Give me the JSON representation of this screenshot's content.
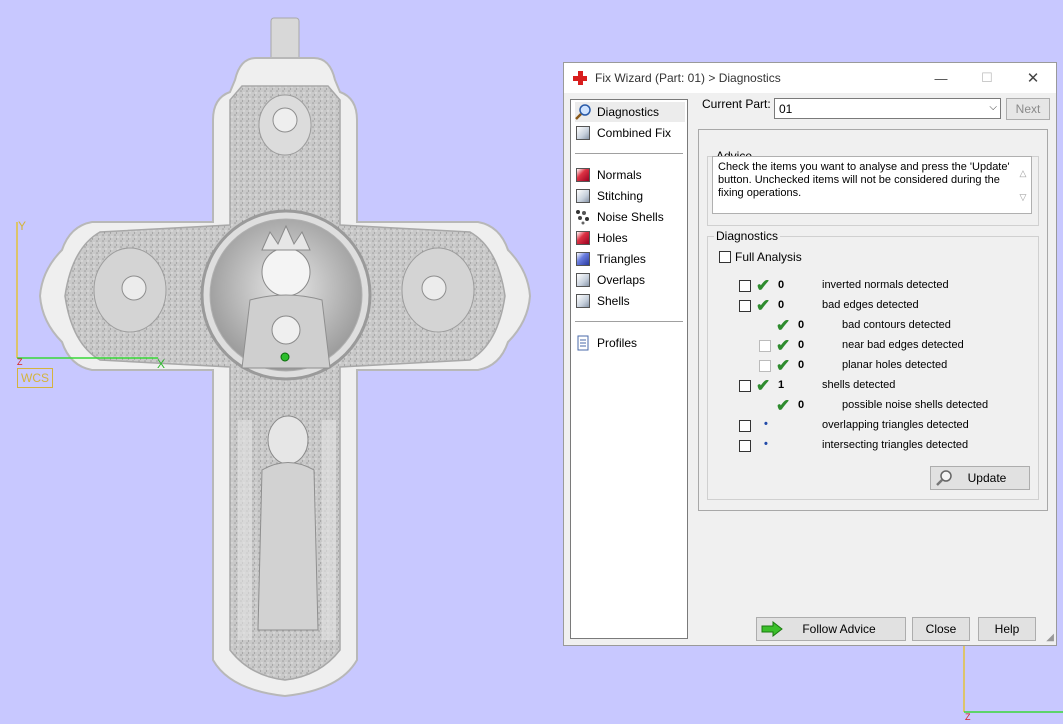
{
  "viewport": {
    "axis_y_label": "Y",
    "axis_x_label": "X",
    "axis_z_label": "Z",
    "wcs_badge": "WCS",
    "background_color": "#c8c8ff"
  },
  "window": {
    "title": "Fix Wizard (Part: 01) > Diagnostics",
    "title_icon": "red-cross-icon",
    "minimize_glyph": "—",
    "maximize_glyph": "☐",
    "close_glyph": "✕"
  },
  "sidebar": {
    "items": [
      {
        "label": "Diagnostics",
        "icon": "magnifier-icon",
        "active": true
      },
      {
        "label": "Combined Fix",
        "icon": "cube-icon"
      },
      {
        "label": "Normals",
        "icon": "red-cube-icon"
      },
      {
        "label": "Stitching",
        "icon": "cube-icon"
      },
      {
        "label": "Noise Shells",
        "icon": "dotted-cube-icon"
      },
      {
        "label": "Holes",
        "icon": "red-cube-icon"
      },
      {
        "label": "Triangles",
        "icon": "blue-cube-icon"
      },
      {
        "label": "Overlaps",
        "icon": "cube-icon"
      },
      {
        "label": "Shells",
        "icon": "cube-icon"
      },
      {
        "label": "Profiles",
        "icon": "document-icon"
      }
    ]
  },
  "current_part": {
    "label": "Current Part:",
    "value": "01",
    "next_button": "Next"
  },
  "advice": {
    "title": "Advice",
    "text": "Check the items you want to analyse and press the 'Update' button. Unchecked items will not be considered during the fixing operations."
  },
  "diagnostics": {
    "title": "Diagnostics",
    "full_analysis_label": "Full Analysis",
    "rows": [
      {
        "label": "inverted normals detected",
        "count": "0",
        "status": "ok"
      },
      {
        "label": "bad edges detected",
        "count": "0",
        "status": "ok"
      },
      {
        "label": "bad contours detected",
        "count": "0",
        "status": "ok"
      },
      {
        "label": "near bad edges detected",
        "count": "0",
        "status": "ok"
      },
      {
        "label": "planar holes detected",
        "count": "0",
        "status": "ok"
      },
      {
        "label": "shells detected",
        "count": "1",
        "status": "ok"
      },
      {
        "label": "possible noise shells detected",
        "count": "0",
        "status": "ok"
      },
      {
        "label": "overlapping triangles detected",
        "count": "•",
        "status": "pending"
      },
      {
        "label": "intersecting triangles detected",
        "count": "•",
        "status": "pending"
      }
    ],
    "update_button": "Update"
  },
  "footer": {
    "follow_advice": "Follow Advice",
    "close": "Close",
    "help": "Help"
  },
  "colors": {
    "check_green": "#2e8b2e",
    "accent_red": "#d81e1e"
  }
}
